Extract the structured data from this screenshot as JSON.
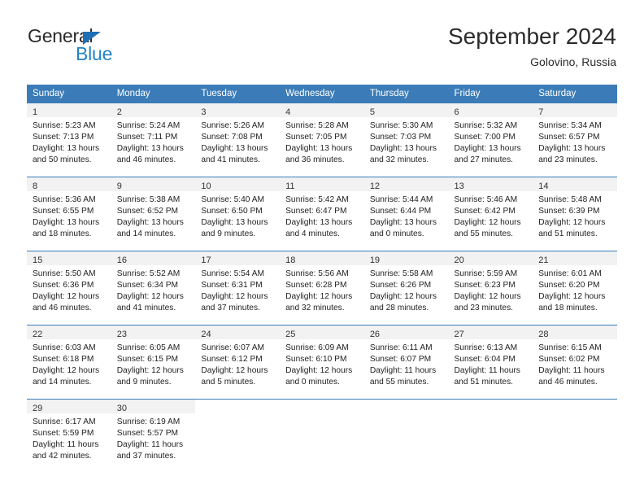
{
  "brand": {
    "name_top": "General",
    "name_bottom": "Blue",
    "triangle_color": "#1f6fb5",
    "blue_color": "#2383c4"
  },
  "header": {
    "month_title": "September 2024",
    "location": "Golovino, Russia"
  },
  "theme": {
    "header_blue": "#3b7cb8",
    "daynum_band": "#f2f2f2",
    "text": "#222222"
  },
  "weekdays": [
    "Sunday",
    "Monday",
    "Tuesday",
    "Wednesday",
    "Thursday",
    "Friday",
    "Saturday"
  ],
  "weeks": [
    [
      {
        "day": "1",
        "sunrise": "Sunrise: 5:23 AM",
        "sunset": "Sunset: 7:13 PM",
        "daylight1": "Daylight: 13 hours",
        "daylight2": "and 50 minutes."
      },
      {
        "day": "2",
        "sunrise": "Sunrise: 5:24 AM",
        "sunset": "Sunset: 7:11 PM",
        "daylight1": "Daylight: 13 hours",
        "daylight2": "and 46 minutes."
      },
      {
        "day": "3",
        "sunrise": "Sunrise: 5:26 AM",
        "sunset": "Sunset: 7:08 PM",
        "daylight1": "Daylight: 13 hours",
        "daylight2": "and 41 minutes."
      },
      {
        "day": "4",
        "sunrise": "Sunrise: 5:28 AM",
        "sunset": "Sunset: 7:05 PM",
        "daylight1": "Daylight: 13 hours",
        "daylight2": "and 36 minutes."
      },
      {
        "day": "5",
        "sunrise": "Sunrise: 5:30 AM",
        "sunset": "Sunset: 7:03 PM",
        "daylight1": "Daylight: 13 hours",
        "daylight2": "and 32 minutes."
      },
      {
        "day": "6",
        "sunrise": "Sunrise: 5:32 AM",
        "sunset": "Sunset: 7:00 PM",
        "daylight1": "Daylight: 13 hours",
        "daylight2": "and 27 minutes."
      },
      {
        "day": "7",
        "sunrise": "Sunrise: 5:34 AM",
        "sunset": "Sunset: 6:57 PM",
        "daylight1": "Daylight: 13 hours",
        "daylight2": "and 23 minutes."
      }
    ],
    [
      {
        "day": "8",
        "sunrise": "Sunrise: 5:36 AM",
        "sunset": "Sunset: 6:55 PM",
        "daylight1": "Daylight: 13 hours",
        "daylight2": "and 18 minutes."
      },
      {
        "day": "9",
        "sunrise": "Sunrise: 5:38 AM",
        "sunset": "Sunset: 6:52 PM",
        "daylight1": "Daylight: 13 hours",
        "daylight2": "and 14 minutes."
      },
      {
        "day": "10",
        "sunrise": "Sunrise: 5:40 AM",
        "sunset": "Sunset: 6:50 PM",
        "daylight1": "Daylight: 13 hours",
        "daylight2": "and 9 minutes."
      },
      {
        "day": "11",
        "sunrise": "Sunrise: 5:42 AM",
        "sunset": "Sunset: 6:47 PM",
        "daylight1": "Daylight: 13 hours",
        "daylight2": "and 4 minutes."
      },
      {
        "day": "12",
        "sunrise": "Sunrise: 5:44 AM",
        "sunset": "Sunset: 6:44 PM",
        "daylight1": "Daylight: 13 hours",
        "daylight2": "and 0 minutes."
      },
      {
        "day": "13",
        "sunrise": "Sunrise: 5:46 AM",
        "sunset": "Sunset: 6:42 PM",
        "daylight1": "Daylight: 12 hours",
        "daylight2": "and 55 minutes."
      },
      {
        "day": "14",
        "sunrise": "Sunrise: 5:48 AM",
        "sunset": "Sunset: 6:39 PM",
        "daylight1": "Daylight: 12 hours",
        "daylight2": "and 51 minutes."
      }
    ],
    [
      {
        "day": "15",
        "sunrise": "Sunrise: 5:50 AM",
        "sunset": "Sunset: 6:36 PM",
        "daylight1": "Daylight: 12 hours",
        "daylight2": "and 46 minutes."
      },
      {
        "day": "16",
        "sunrise": "Sunrise: 5:52 AM",
        "sunset": "Sunset: 6:34 PM",
        "daylight1": "Daylight: 12 hours",
        "daylight2": "and 41 minutes."
      },
      {
        "day": "17",
        "sunrise": "Sunrise: 5:54 AM",
        "sunset": "Sunset: 6:31 PM",
        "daylight1": "Daylight: 12 hours",
        "daylight2": "and 37 minutes."
      },
      {
        "day": "18",
        "sunrise": "Sunrise: 5:56 AM",
        "sunset": "Sunset: 6:28 PM",
        "daylight1": "Daylight: 12 hours",
        "daylight2": "and 32 minutes."
      },
      {
        "day": "19",
        "sunrise": "Sunrise: 5:58 AM",
        "sunset": "Sunset: 6:26 PM",
        "daylight1": "Daylight: 12 hours",
        "daylight2": "and 28 minutes."
      },
      {
        "day": "20",
        "sunrise": "Sunrise: 5:59 AM",
        "sunset": "Sunset: 6:23 PM",
        "daylight1": "Daylight: 12 hours",
        "daylight2": "and 23 minutes."
      },
      {
        "day": "21",
        "sunrise": "Sunrise: 6:01 AM",
        "sunset": "Sunset: 6:20 PM",
        "daylight1": "Daylight: 12 hours",
        "daylight2": "and 18 minutes."
      }
    ],
    [
      {
        "day": "22",
        "sunrise": "Sunrise: 6:03 AM",
        "sunset": "Sunset: 6:18 PM",
        "daylight1": "Daylight: 12 hours",
        "daylight2": "and 14 minutes."
      },
      {
        "day": "23",
        "sunrise": "Sunrise: 6:05 AM",
        "sunset": "Sunset: 6:15 PM",
        "daylight1": "Daylight: 12 hours",
        "daylight2": "and 9 minutes."
      },
      {
        "day": "24",
        "sunrise": "Sunrise: 6:07 AM",
        "sunset": "Sunset: 6:12 PM",
        "daylight1": "Daylight: 12 hours",
        "daylight2": "and 5 minutes."
      },
      {
        "day": "25",
        "sunrise": "Sunrise: 6:09 AM",
        "sunset": "Sunset: 6:10 PM",
        "daylight1": "Daylight: 12 hours",
        "daylight2": "and 0 minutes."
      },
      {
        "day": "26",
        "sunrise": "Sunrise: 6:11 AM",
        "sunset": "Sunset: 6:07 PM",
        "daylight1": "Daylight: 11 hours",
        "daylight2": "and 55 minutes."
      },
      {
        "day": "27",
        "sunrise": "Sunrise: 6:13 AM",
        "sunset": "Sunset: 6:04 PM",
        "daylight1": "Daylight: 11 hours",
        "daylight2": "and 51 minutes."
      },
      {
        "day": "28",
        "sunrise": "Sunrise: 6:15 AM",
        "sunset": "Sunset: 6:02 PM",
        "daylight1": "Daylight: 11 hours",
        "daylight2": "and 46 minutes."
      }
    ],
    [
      {
        "day": "29",
        "sunrise": "Sunrise: 6:17 AM",
        "sunset": "Sunset: 5:59 PM",
        "daylight1": "Daylight: 11 hours",
        "daylight2": "and 42 minutes."
      },
      {
        "day": "30",
        "sunrise": "Sunrise: 6:19 AM",
        "sunset": "Sunset: 5:57 PM",
        "daylight1": "Daylight: 11 hours",
        "daylight2": "and 37 minutes."
      },
      {
        "day": "",
        "sunrise": "",
        "sunset": "",
        "daylight1": "",
        "daylight2": ""
      },
      {
        "day": "",
        "sunrise": "",
        "sunset": "",
        "daylight1": "",
        "daylight2": ""
      },
      {
        "day": "",
        "sunrise": "",
        "sunset": "",
        "daylight1": "",
        "daylight2": ""
      },
      {
        "day": "",
        "sunrise": "",
        "sunset": "",
        "daylight1": "",
        "daylight2": ""
      },
      {
        "day": "",
        "sunrise": "",
        "sunset": "",
        "daylight1": "",
        "daylight2": ""
      }
    ]
  ]
}
